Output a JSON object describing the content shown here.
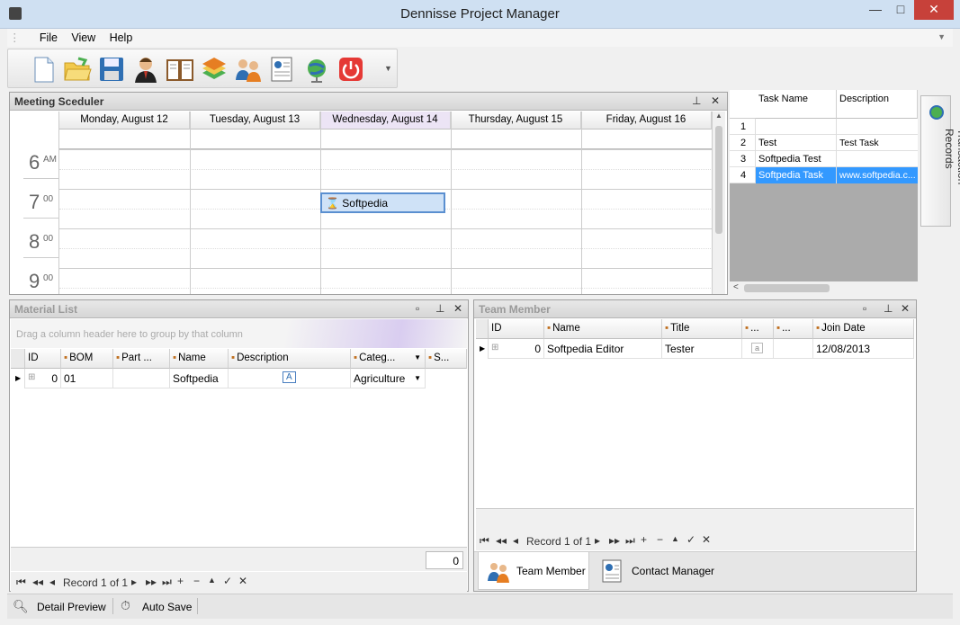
{
  "window": {
    "title": "Dennisse Project Manager",
    "min": "—",
    "max": "□",
    "close": "✕"
  },
  "menu": [
    "File",
    "View",
    "Help"
  ],
  "toolbar": {
    "icons": [
      "new-document-icon",
      "open-folder-icon",
      "save-icon",
      "user-icon",
      "book-icon",
      "materials-icon",
      "team-icon",
      "contact-card-icon",
      "globe-icon",
      "power-icon"
    ]
  },
  "scheduler": {
    "title": "Meeting Sceduler",
    "days": [
      "Monday, August 12",
      "Tuesday, August 13",
      "Wednesday, August 14",
      "Thursday, August 15",
      "Friday, August 16"
    ],
    "hours": [
      {
        "h": "6",
        "m": "AM"
      },
      {
        "h": "7",
        "m": "00"
      },
      {
        "h": "8",
        "m": "00"
      },
      {
        "h": "9",
        "m": "00"
      }
    ],
    "appointment": "Softpedia"
  },
  "tasks": {
    "headers": [
      "Task Name",
      "Description"
    ],
    "rows": [
      {
        "n": "1",
        "name": "",
        "desc": ""
      },
      {
        "n": "2",
        "name": "Test",
        "desc": "Test Task"
      },
      {
        "n": "3",
        "name": "Softpedia Test",
        "desc": ""
      },
      {
        "n": "4",
        "name": "Softpedia Task",
        "desc": "www.softpedia.c..."
      }
    ]
  },
  "side_tab": "Transaction Records",
  "material": {
    "title": "Material List",
    "group_hint": "Drag a column header here to group by that column",
    "headers": [
      "ID",
      "BOM",
      "Part ...",
      "Name",
      "Description",
      "Categ...",
      "S..."
    ],
    "row": {
      "id": "0",
      "bom": "01",
      "part": "",
      "name": "Softpedia",
      "desc": "",
      "category": "Agriculture"
    },
    "footer_value": "0",
    "record": "Record 1 of 1"
  },
  "team": {
    "title": "Team Member",
    "headers": [
      "ID",
      "Name",
      "Title",
      "...",
      "...",
      "Join Date"
    ],
    "row": {
      "id": "0",
      "name": "Softpedia Editor",
      "title": "Tester",
      "join": "12/08/2013"
    },
    "record": "Record 1 of 1",
    "tabs": [
      "Team Member",
      "Contact Manager"
    ]
  },
  "status": {
    "detail": "Detail Preview",
    "autosave": "Auto Save"
  },
  "colors": {
    "selection": "#3399ff",
    "appointment": "#cfe2f7",
    "wed_header": "#ece4f5"
  }
}
